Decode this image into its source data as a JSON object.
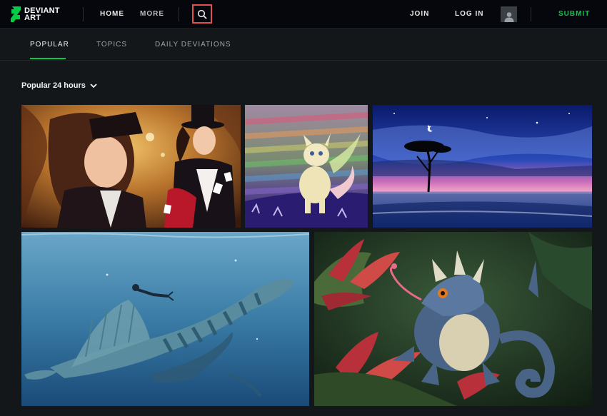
{
  "header": {
    "logo_line1": "DEVIANT",
    "logo_line2": "ART",
    "nav": {
      "home": "HOME",
      "more": "MORE",
      "join": "JOIN",
      "login": "LOG IN",
      "submit": "SUBMIT"
    },
    "icons": {
      "search": "search-icon",
      "avatar": "user-avatar-icon",
      "logo": "deviantart-logo-icon"
    }
  },
  "tabs": [
    {
      "label": "POPULAR",
      "active": true
    },
    {
      "label": "TOPICS",
      "active": false
    },
    {
      "label": "DAILY DEVIATIONS",
      "active": false
    }
  ],
  "sort": {
    "label": "Popular 24 hours",
    "icon": "chevron-down-icon"
  },
  "colors": {
    "accent": "#05cc47",
    "search_highlight": "#e0504e",
    "background": "#14171a",
    "topbar": "#06070d"
  }
}
